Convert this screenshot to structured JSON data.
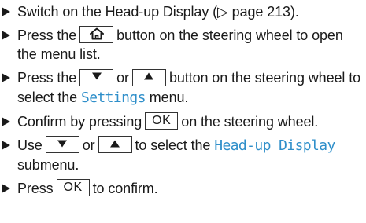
{
  "steps": [
    {
      "parts": [
        "Switch on the Head-up Display (",
        "▷",
        " page 213)."
      ]
    },
    {
      "parts": [
        "Press the",
        "button on the steering wheel to open the menu list."
      ],
      "key_icon": "home-icon"
    },
    {
      "parts": [
        "Press the",
        "or",
        "button on the steering wheel to select the",
        "menu."
      ],
      "menu": "Settings",
      "key_icons": [
        "triangle-down-icon",
        "triangle-up-icon"
      ]
    },
    {
      "parts": [
        "Confirm by pressing",
        "on the steering wheel."
      ],
      "key_label": "OK"
    },
    {
      "parts": [
        "Use",
        "or",
        "to select the",
        "submenu."
      ],
      "menu": "Head-up Display",
      "key_icons": [
        "triangle-down-icon",
        "triangle-up-icon"
      ]
    },
    {
      "parts": [
        "Press",
        "to confirm."
      ],
      "key_label": "OK"
    }
  ],
  "colors": {
    "menu_text": "#2f8fca",
    "body_text": "#1a1a1a"
  }
}
